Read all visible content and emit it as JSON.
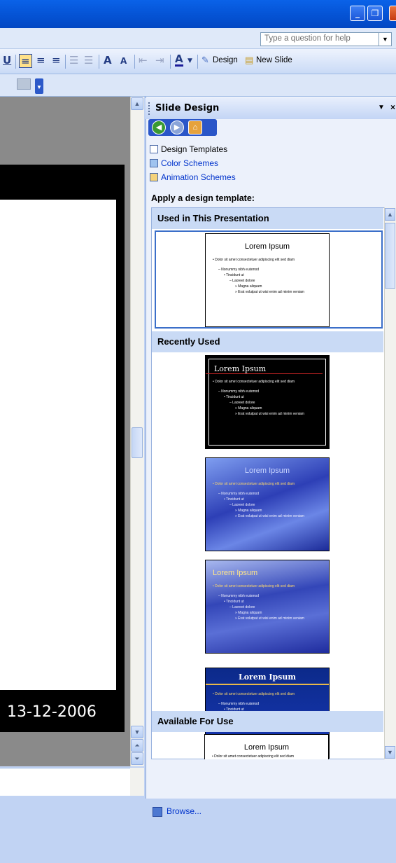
{
  "help": {
    "placeholder": "Type a question for help"
  },
  "toolbar": {
    "design_label": "Design",
    "new_slide_label": "New Slide"
  },
  "slide": {
    "date": "13-12-2006"
  },
  "taskpane": {
    "title": "Slide Design",
    "links": [
      "Design Templates",
      "Color Schemes",
      "Animation Schemes"
    ],
    "apply_label": "Apply a design template:",
    "groups": {
      "used": "Used in This Presentation",
      "recent": "Recently Used",
      "available": "Available For Use"
    },
    "browse_label": "Browse..."
  },
  "thumbnails": {
    "title": "Lorem Ipsum",
    "bullet1": "• Dolor sit amet consectetuer adipiscing elit sed diam",
    "bullet2": "– Nonummy nibh euismod",
    "bullet3": "• Tincidunt ut",
    "bullet4": "– Laoreet dolore",
    "bullet5": "» Magna aliquam",
    "bullet6": "» Erat volutpat ut wisi enim ad minim veniam"
  },
  "colors": {
    "titlebar": "#0554d6",
    "accent": "#0033cc",
    "group_header": "#c9daf5"
  }
}
